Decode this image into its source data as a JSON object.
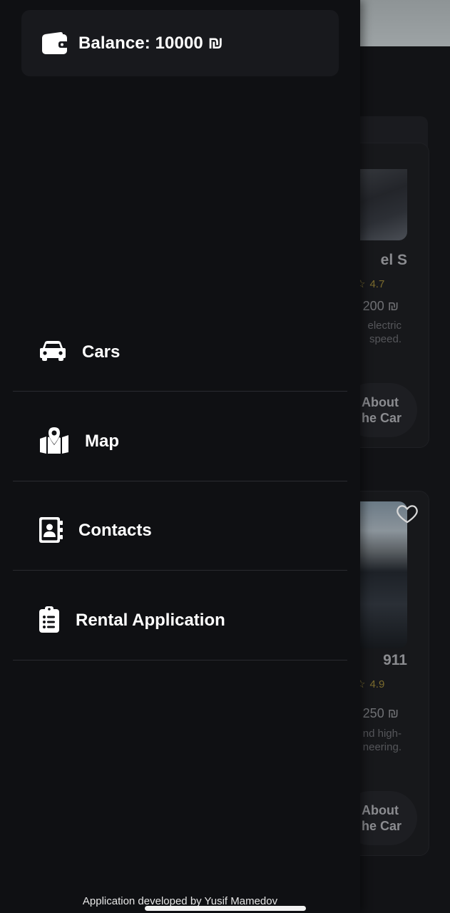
{
  "drawer": {
    "balance_label": "Balance: 10000 ₪",
    "menu": [
      {
        "label": "Cars",
        "icon": "car-icon"
      },
      {
        "label": "Map",
        "icon": "map-icon"
      },
      {
        "label": "Contacts",
        "icon": "contacts-icon"
      },
      {
        "label": "Rental Application",
        "icon": "clipboard-list-icon"
      }
    ],
    "footer": "Application developed by Yusif Mamedov"
  },
  "background": {
    "cards": [
      {
        "name": "el S",
        "rating": "4.7",
        "price": "200 ₪",
        "desc_line1": "electric",
        "desc_line2": "speed.",
        "about_line1": "About",
        "about_line2": "he Car"
      },
      {
        "name": "911",
        "rating": "4.9",
        "price": "250 ₪",
        "desc_line1": "nd high-",
        "desc_line2": "neering.",
        "about_line1": "About",
        "about_line2": "he Car"
      }
    ]
  },
  "colors": {
    "drawer_bg": "#0f1013",
    "balance_card_bg": "#18191d",
    "divider": "#2a2b30",
    "text": "#ffffff",
    "rating_star": "#8a7a35"
  }
}
